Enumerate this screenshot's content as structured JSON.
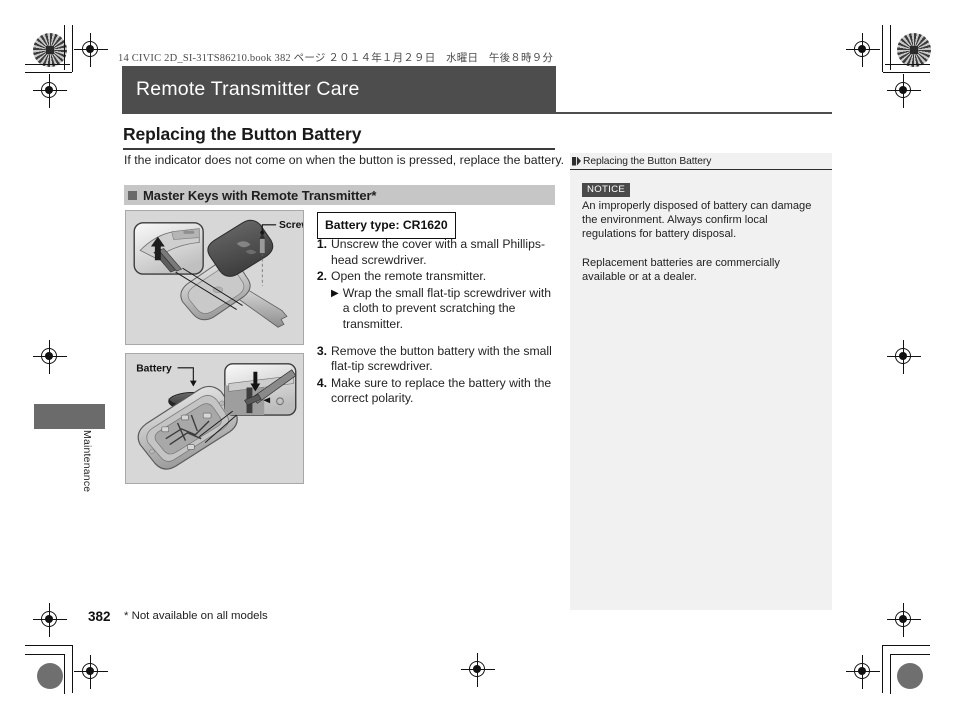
{
  "print_header": {
    "slug": "14 CIVIC 2D_SI-31TS86210.book   382 ページ   ２０１４年１月２９日　水曜日　午後８時９分"
  },
  "chapter": {
    "banner_title": "Remote Transmitter Care"
  },
  "section": {
    "heading": "Replacing the Button Battery",
    "intro": "If the indicator does not come on when the button is pressed, replace the battery."
  },
  "subsection": {
    "label": "Master Keys with Remote Transmitter*",
    "bullet_icon": "filled-square-icon"
  },
  "figures": {
    "screw": {
      "callout": "Screw",
      "alt": "remote transmitter key fob exploded view showing cover, screw and key blade"
    },
    "battery": {
      "callout": "Battery",
      "alt": "opened remote transmitter showing button battery being removed with flat-tip screwdriver"
    }
  },
  "procedure": {
    "battery_type": "Battery type: CR1620",
    "steps": [
      {
        "num": "1.",
        "text": "Unscrew the cover with a small Phillips-head screwdriver."
      },
      {
        "num": "2.",
        "text": "Open the remote transmitter.",
        "substeps": [
          {
            "marker": "▶",
            "text": "Wrap the small flat-tip screwdriver with a cloth to prevent scratching the transmitter."
          }
        ]
      },
      {
        "num": "3.",
        "text": "Remove the button battery with the small flat-tip screwdriver."
      },
      {
        "num": "4.",
        "text": "Make sure to replace the battery with the correct polarity."
      }
    ]
  },
  "reference_panel": {
    "header_icon": "double-chevron-icon",
    "header_title": "Replacing the Button Battery",
    "notice_badge": "NOTICE",
    "notice_paragraphs": [
      "An improperly disposed of battery can damage the environment. Always confirm local regulations for battery disposal.",
      "Replacement batteries are commercially available or at a dealer."
    ]
  },
  "thumb_tab": {
    "label": "Maintenance"
  },
  "footer": {
    "page_number": "382",
    "footnote": "* Not available on all models"
  },
  "colors": {
    "banner": "#4d4d4d",
    "subsection_bar": "#c6c6c6",
    "panel_bg": "#f1f1f1",
    "notice_badge": "#4a4a4a",
    "figure_bg": "#d7d7d7",
    "thumb_tab": "#6b6b6b"
  }
}
